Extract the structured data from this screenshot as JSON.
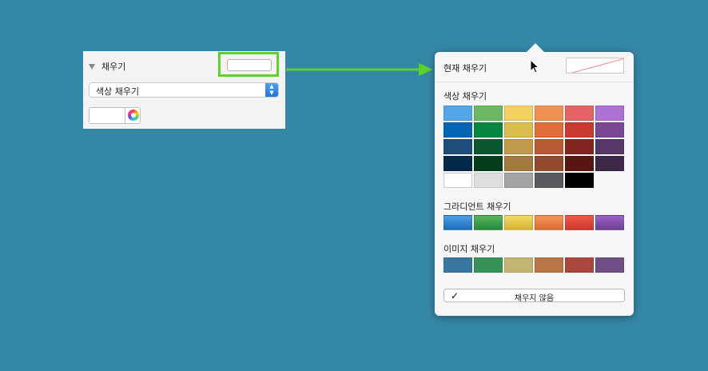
{
  "inspector": {
    "section_title": "채우기",
    "fill_type": "색상 채우기",
    "stepper_icon": "up-down-chevron"
  },
  "popover": {
    "current_fill_label": "현재 채우기",
    "color_fill_label": "색상 채우기",
    "gradient_fill_label": "그라디언트 채우기",
    "image_fill_label": "이미지 채우기",
    "no_fill_button": "채우지 않음",
    "check_mark": "✓",
    "color_rows": [
      [
        "#53a7e8",
        "#6cb862",
        "#f3d05f",
        "#ef9251",
        "#e56266",
        "#ad70d3"
      ],
      [
        "#0466b2",
        "#068540",
        "#dabb4d",
        "#df6e3a",
        "#c83b30",
        "#7b4795"
      ],
      [
        "#1d4e7b",
        "#0b5830",
        "#c0994a",
        "#b65b31",
        "#832420",
        "#563768"
      ],
      [
        "#02284a",
        "#043d1c",
        "#a17a3c",
        "#934a2b",
        "#581512",
        "#3e2847"
      ],
      [
        "#ffffff",
        "#dedede",
        "#a3a3a3",
        "#5a5a5e",
        "#000000"
      ]
    ],
    "gradient_row": [
      [
        "#4e9fe6",
        "#1b6dbd"
      ],
      [
        "#5db55c",
        "#1e8a3a"
      ],
      [
        "#f1d96a",
        "#d6b22f"
      ],
      [
        "#f29655",
        "#de6a32"
      ],
      [
        "#ee5a4a",
        "#cc3529"
      ],
      [
        "#9a64c2",
        "#6d3e95"
      ]
    ],
    "image_row": [
      "#3a77a0",
      "#379257",
      "#c2b471",
      "#b87646",
      "#a9473e",
      "#6f4f86"
    ]
  }
}
